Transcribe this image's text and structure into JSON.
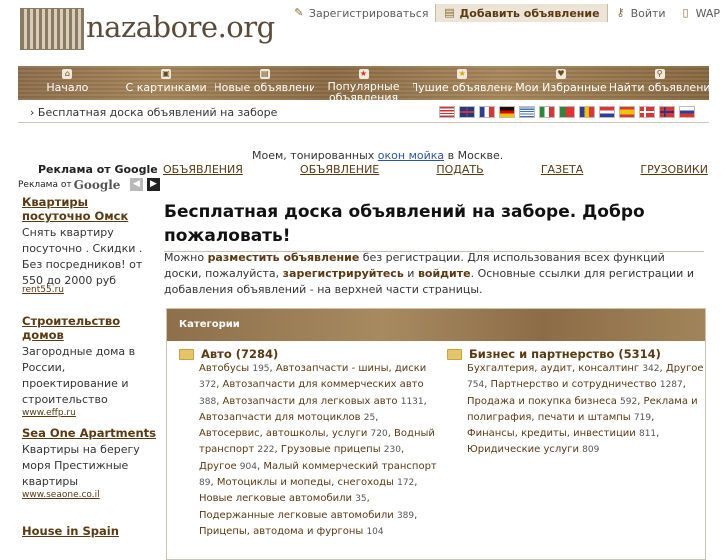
{
  "logo": {
    "text": "nazabore.org"
  },
  "toplinks": [
    {
      "icon": "pencil-icon",
      "label": "Зарегистрироваться"
    },
    {
      "icon": "add-doc-icon",
      "label": "Добавить объявление"
    },
    {
      "icon": "key-icon",
      "label": "Войти"
    },
    {
      "icon": "phone-icon",
      "label": "WAP"
    }
  ],
  "nav": [
    {
      "icon": "home-icon",
      "label": "Начало"
    },
    {
      "icon": "pictures-icon",
      "label": "С картинками"
    },
    {
      "icon": "new-icon",
      "label": "Новые объявлени"
    },
    {
      "icon": "star-red-icon",
      "label": "Популярные объявления"
    },
    {
      "icon": "star-icon",
      "label": "Лушие объявлени"
    },
    {
      "icon": "favorites-icon",
      "label": "Мои Избранные"
    },
    {
      "icon": "search-icon",
      "label": "Найти объявлени"
    }
  ],
  "breadcrumb": "Бесплатная доска объявлений на заборе",
  "flags": [
    "en-us",
    "en-gb",
    "fr",
    "de",
    "gr",
    "it",
    "pt",
    "ro",
    "nl",
    "es",
    "dk",
    "no",
    "ru"
  ],
  "promo": {
    "before": "Моем, тонированных ",
    "link": "окон мойка",
    "after": " в Москве."
  },
  "adlinks": [
    "ОБЪЯВЛЕНИЯ",
    "ОБЪЯВЛЕНИЕ",
    "ПОДАТЬ",
    "ГАЗЕТА",
    "ГРУЗОВИКИ"
  ],
  "leftads": {
    "header": "Реклама от Google",
    "subheader": "Реклама от",
    "subheader_brand": "Google",
    "ads": [
      {
        "title": "Квартиры посуточно Омск",
        "body": "Снять квартиру посуточно . Скидки . Без посредников! от 550 до 2000 руб",
        "url": "rent55.ru"
      },
      {
        "title": "Строительство домов",
        "body": "Загородные дома в России, проектирование и строительство",
        "url": "www.effp.ru"
      },
      {
        "title": "Sea One Apartments",
        "body": "Квартиры на берегу моря Престижные квартиры",
        "url": "www.seaone.co.il"
      },
      {
        "title": "House in Spain",
        "body": "",
        "url": ""
      }
    ]
  },
  "main": {
    "heading": "Бесплатная доска объявлений на заборе. Добро пожаловать!",
    "intro_1": "Можно ",
    "intro_bold_1": "разместить объявление",
    "intro_2": " без регистрации. Для использования всех функций доски, пожалуйста, ",
    "intro_bold_2": "зарегистрируйтесь",
    "intro_3": " и ",
    "intro_bold_3": "войдите",
    "intro_4": ". Основные ссылки для регистрации и добавления объявлений - на верхней части страницы."
  },
  "categories": {
    "title": "Категории",
    "columns": [
      {
        "name": "Авто (7284)",
        "items": [
          [
            "Автобусы",
            "195"
          ],
          [
            "Автозапчасти - шины, диски",
            "372"
          ],
          [
            "Автозапчасти для коммерческих авто",
            "388"
          ],
          [
            "Автозапчасти для легковых авто",
            "1131"
          ],
          [
            "Автозапчасти для мотоциклов",
            "25"
          ],
          [
            "Автосервис, автошколы, услуги",
            "720"
          ],
          [
            "Водный транспорт",
            "222"
          ],
          [
            "Грузовые прицепы",
            "230"
          ],
          [
            "Другое",
            "904"
          ],
          [
            "Малый коммерческий транспорт",
            "89"
          ],
          [
            "Мотоциклы и мопеды, снегоходы",
            "172"
          ],
          [
            "Новые легковые автомобили",
            "35"
          ],
          [
            "Подержанные легковые автомобили",
            "389"
          ],
          [
            "Прицепы, автодома и фургоны",
            "104"
          ]
        ]
      },
      {
        "name": "Бизнес и партнерство (5314)",
        "items": [
          [
            "Бухгалтерия, аудит, консалтинг",
            "342"
          ],
          [
            "Другое",
            "754"
          ],
          [
            "Партнерство и сотрудничество",
            "1287"
          ],
          [
            "Продажа и покупка бизнеса",
            "592"
          ],
          [
            "Реклама и полиграфия, печати и штампы",
            "719"
          ],
          [
            "Финансы, кредиты, инвестиции",
            "811"
          ],
          [
            "Юридические услуги",
            "809"
          ]
        ]
      }
    ]
  }
}
